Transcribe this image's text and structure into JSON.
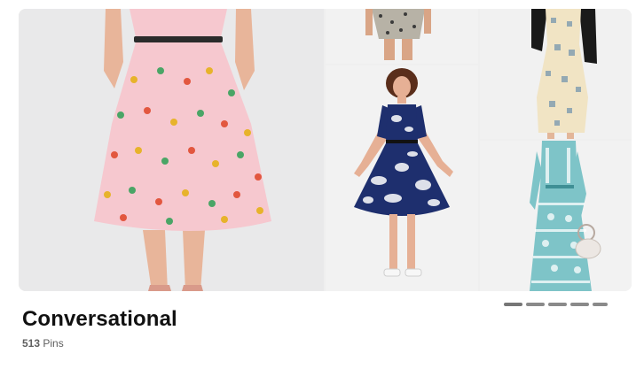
{
  "board": {
    "title": "Conversational",
    "pin_count": "513",
    "pin_label": "Pins"
  },
  "pager": {
    "page_count": 5,
    "active_index": 0
  },
  "images": [
    {
      "name": "pineapple-print-pink-dress",
      "colors": {
        "fabric": "#f6c8cf",
        "belt": "#2b2b2b",
        "skin": "#e8b59a"
      }
    },
    {
      "name": "leopard-print-dress-hem",
      "colors": {
        "fabric": "#b7b2a6",
        "skin": "#d9a586"
      }
    },
    {
      "name": "navy-floral-dress",
      "colors": {
        "fabric": "#1e2f6e",
        "accent": "#ffffff",
        "skin": "#e6b095"
      }
    },
    {
      "name": "cream-novelty-print-dress",
      "colors": {
        "fabric": "#f1e4c4",
        "jacket": "#1a1a1a"
      }
    },
    {
      "name": "teal-bandana-print-dress",
      "colors": {
        "fabric": "#7ec4c8",
        "accent": "#ffffff"
      }
    }
  ]
}
